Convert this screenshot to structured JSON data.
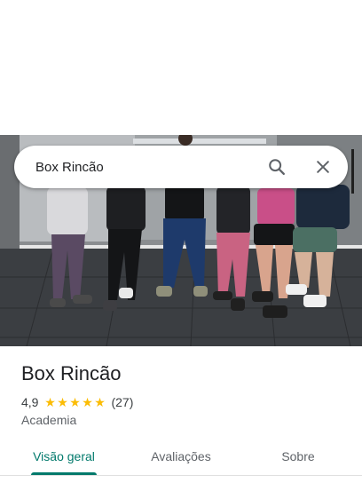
{
  "search": {
    "query": "Box Rincão",
    "search_icon": "search-icon",
    "close_icon": "close-icon"
  },
  "place": {
    "name": "Box Rincão",
    "rating": "4,9",
    "stars": [
      "★",
      "★",
      "★",
      "★",
      "★"
    ],
    "review_count": "(27)",
    "category": "Academia"
  },
  "tabs": [
    {
      "label": "Visão geral",
      "active": true
    },
    {
      "label": "Avaliações",
      "active": false
    },
    {
      "label": "Sobre",
      "active": false
    }
  ],
  "colors": {
    "accent": "#00796b",
    "star": "#fbbc04",
    "text": "#202124",
    "secondary_text": "#5f6368"
  }
}
